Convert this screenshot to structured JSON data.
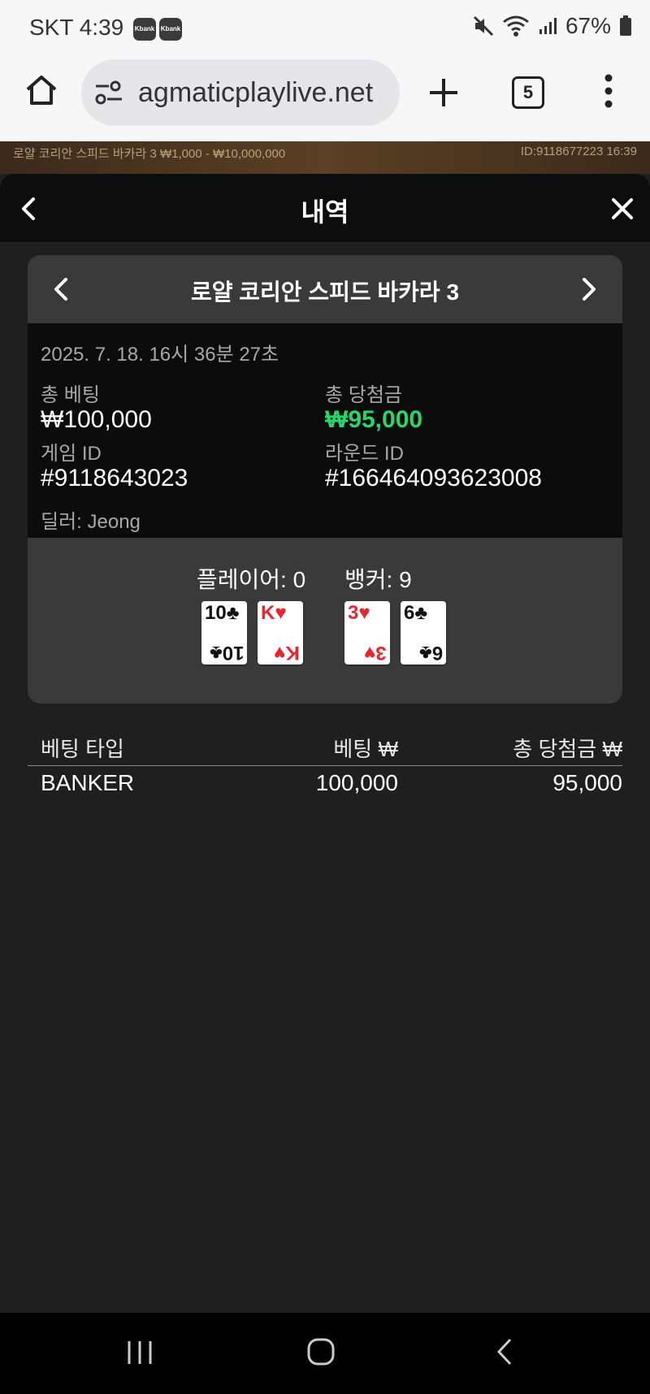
{
  "status_bar": {
    "carrier_time": "SKT 4:39",
    "kbank_1": "Kbank",
    "kbank_2": "Kbank",
    "battery": "67%"
  },
  "browser": {
    "url": "agmaticplaylive.net",
    "tab_count": "5"
  },
  "game_strip": {
    "left_text": "로얄 코리안 스피드 바카라 3  ₩1,000 - ₩10,000,000",
    "right_text": "ID:9118677223  16:39"
  },
  "panel": {
    "title": "내역"
  },
  "round": {
    "game_name": "로얄 코리안 스피드 바카라 3",
    "datetime": "2025. 7. 18. 16시 36분 27초",
    "total_bet_label": "총 베팅",
    "total_bet_value": "₩100,000",
    "total_win_label": "총 당첨금",
    "total_win_value": "₩95,000",
    "game_id_label": "게임 ID",
    "game_id_value": "#9118643023",
    "round_id_label": "라운드 ID",
    "round_id_value": "#166464093623008",
    "dealer": "딜러: Jeong",
    "player_label": "플레이어: 0",
    "banker_label": "뱅커: 9",
    "player_cards": [
      {
        "rank": "10",
        "suit": "♣",
        "color": "#111111"
      },
      {
        "rank": "K",
        "suit": "♥",
        "color": "#e8262f"
      }
    ],
    "banker_cards": [
      {
        "rank": "3",
        "suit": "♥",
        "color": "#e8262f"
      },
      {
        "rank": "6",
        "suit": "♣",
        "color": "#111111"
      }
    ]
  },
  "bets_table": {
    "headers": [
      "베팅 타입",
      "베팅 ₩",
      "총 당첨금 ₩"
    ],
    "rows": [
      {
        "type": "BANKER",
        "bet": "100,000",
        "win": "95,000"
      }
    ]
  },
  "accent_green": "#2bd36a"
}
